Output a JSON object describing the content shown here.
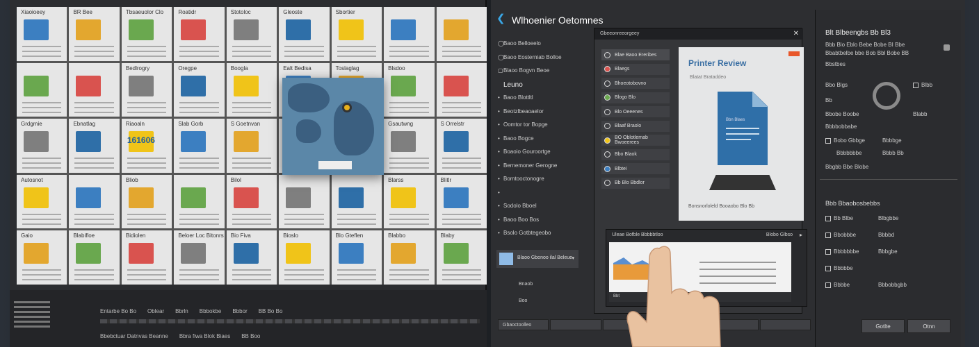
{
  "left_editor": {
    "tiles": [
      {
        "title": "Xiaoioeey"
      },
      {
        "title": "BR Bee"
      },
      {
        "title": "Tbsaeuolor Clo"
      },
      {
        "title": "Roatidr"
      },
      {
        "title": "Stotoloc"
      },
      {
        "title": "Gleoste"
      },
      {
        "title": "Sbortier"
      },
      {
        "title": ""
      },
      {
        "title": ""
      },
      {
        "title": ""
      },
      {
        "title": ""
      },
      {
        "title": "Bedlrogry"
      },
      {
        "title": "Oregpe"
      },
      {
        "title": "Boogla"
      },
      {
        "title": "Ealt Bedisa"
      },
      {
        "title": "Toslaglag"
      },
      {
        "title": "Blsdoo"
      },
      {
        "title": ""
      },
      {
        "title": "Grdgmie"
      },
      {
        "title": "Ebnatlag"
      },
      {
        "title": "Riaoaln"
      },
      {
        "title": "Slab Gorb"
      },
      {
        "title": "S Goetnvan"
      },
      {
        "title": ""
      },
      {
        "title": ""
      },
      {
        "title": "Gsautwng"
      },
      {
        "title": "S Orrelstr"
      },
      {
        "title": "Autosnot"
      },
      {
        "title": ""
      },
      {
        "title": "Bliob"
      },
      {
        "title": ""
      },
      {
        "title": "Bilol"
      },
      {
        "title": ""
      },
      {
        "title": ""
      },
      {
        "title": "Blarss"
      },
      {
        "title": "Blitlr"
      },
      {
        "title": "Gaio"
      },
      {
        "title": "Blabifloe"
      },
      {
        "title": "Bidiolen"
      },
      {
        "title": "Beloer Loc Bitonrs"
      },
      {
        "title": "Bio Fiva"
      },
      {
        "title": "Bioslo"
      },
      {
        "title": "Blo Gteflen"
      },
      {
        "title": "Blabbo"
      },
      {
        "title": "Blaby"
      }
    ],
    "tile_big_text": "161606",
    "timeline_rows": [
      [
        "Entarbe Bo Bo",
        "Oblear",
        "Bbrln",
        "Bbbokbe",
        "Bbbor",
        "BB Bo Bo"
      ],
      [
        "",
        "",
        "",
        "",
        "",
        ""
      ],
      [
        "Bbebctuar Datnvas Beanne",
        "",
        "",
        "Bbra fiwa Blok Biaes",
        "",
        "BB Boo"
      ]
    ]
  },
  "app": {
    "title": "Wlhoenier Oetomnes",
    "sidebar_items": [
      "Baoo Belloeelo",
      "Baoo Eosterniab Bolloe",
      "Blaoo Bogvn Beoe",
      "Leuno",
      "Baoo Blottltl",
      "Beotzlbeaoaelor",
      "Oomtor tor Bopge",
      "Baoo Bogce",
      "Boaoio Gouroortge",
      "Bernemoner Gerogne",
      "Bomtooctonogre",
      "",
      "Sodolo Bboel",
      "Baoo Boo Bos",
      "Bsolo Gotbtegeobo"
    ],
    "sidebar_bottom": [
      "Blaoo Gbonoo ilal Beleue",
      "Bnaob",
      "Boo"
    ],
    "dialog": {
      "title": "Gbeeonreeorgeey",
      "options": [
        "Blae Baoo Ereribes",
        "Blaegs",
        "Bhoeotobovno",
        "Blogo Blo",
        "Blo Oeeenes",
        "Blaaf Braolo",
        "BO Oblotlemab Bwoeerees",
        "Bbo Blaok",
        "Blbtei",
        "Bb Blo Bbdlor"
      ]
    },
    "preview": {
      "title": "Printer Review",
      "subtitle": "Blatat Brataddeo",
      "doc_label": "Bbn Blaes",
      "footer": "Bonsnorloleld Booaobo Blo Bb"
    },
    "shot_panel": {
      "title": "Uleae Bofble Bbbbbtloo",
      "right_label": "Blobo Glbso",
      "screen_footer": "Bbt"
    },
    "bottom_tabs": [
      "Gbaoctoolleo",
      "",
      "",
      "",
      "",
      ""
    ]
  },
  "right_panel": {
    "title": "Blt Blbeengbs Bb Bl3",
    "lines": [
      "Bbb Blo Eblo Bebe Bobe BI Bbe",
      "Bbabtbelbe bbe Bob Bbl Bobe BB",
      "Bbstbes"
    ],
    "groups": [
      {
        "label": "Bbo Blgs",
        "right": "Blbb"
      },
      {
        "label": "Bb"
      },
      {
        "label": "Bbobe Boobe",
        "right": "Blabb"
      },
      {
        "label": "Bbbbobbabe"
      },
      {
        "label": "Bobo Gbbge",
        "right": "Bbbbge"
      },
      {
        "label": "Bbbbbbbe",
        "right": "Bbbb Bb"
      },
      {
        "label": "Bbgbb Bbe Blobe"
      }
    ],
    "section2_title": "Bbb Bbaobosbebbs",
    "section2_rows": [
      {
        "left": "Bb Blbe",
        "right": "Blbgbbe"
      },
      {
        "left": "Bbobbbe",
        "right": "Bbbbd"
      },
      {
        "left": "Bbbbbbbe",
        "right": "Bbbgbe"
      },
      {
        "left": "Bbbbbe",
        "right": ""
      },
      {
        "left": "Bbbbe",
        "right": "Bbbobbgbb"
      }
    ],
    "buttons": {
      "cancel": "Gotlte",
      "ok": "Otnn"
    }
  }
}
